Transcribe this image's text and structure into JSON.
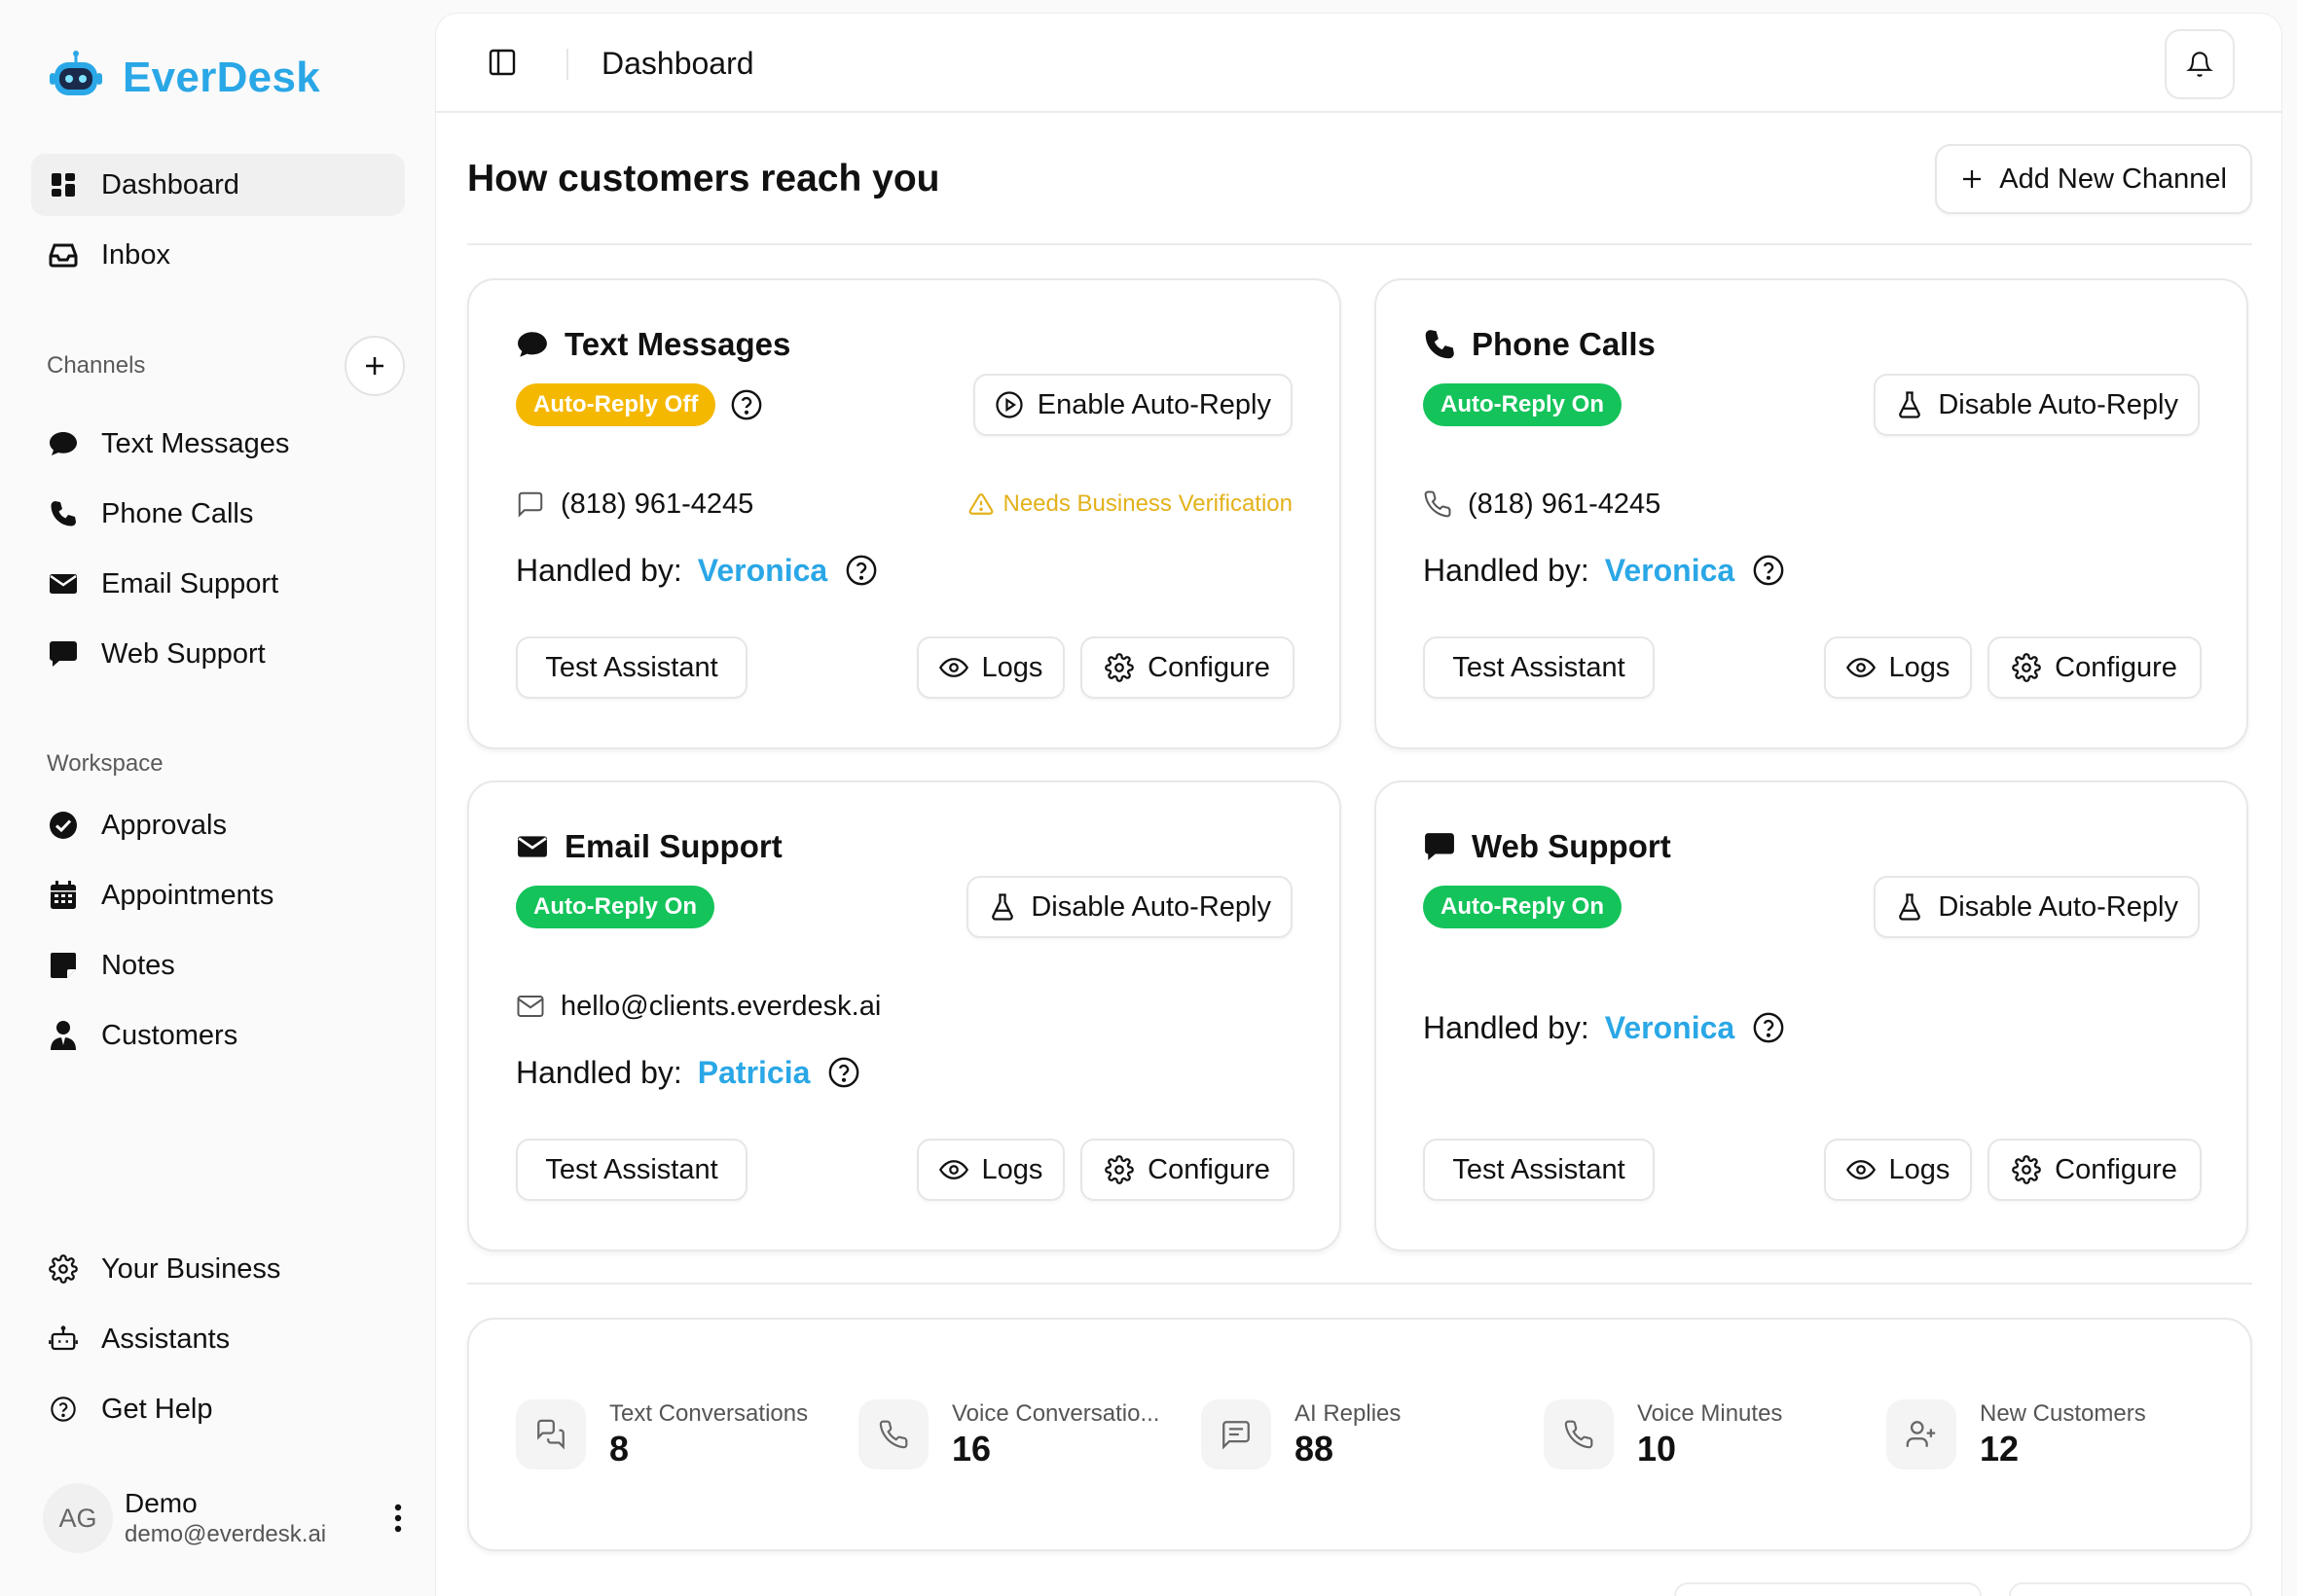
{
  "brand": {
    "name": "EverDesk",
    "accent": "#2aa7e6"
  },
  "sidebar": {
    "main_items": [
      {
        "label": "Dashboard",
        "icon": "dashboard-icon",
        "active": true
      },
      {
        "label": "Inbox",
        "icon": "inbox-icon"
      }
    ],
    "channels_heading": "Channels",
    "channel_items": [
      {
        "label": "Text Messages",
        "icon": "chat-bubble-icon"
      },
      {
        "label": "Phone Calls",
        "icon": "phone-icon"
      },
      {
        "label": "Email Support",
        "icon": "envelope-icon"
      },
      {
        "label": "Web Support",
        "icon": "message-square-icon"
      }
    ],
    "workspace_heading": "Workspace",
    "workspace_items": [
      {
        "label": "Approvals",
        "icon": "check-circle-icon"
      },
      {
        "label": "Appointments",
        "icon": "calendar-icon"
      },
      {
        "label": "Notes",
        "icon": "note-icon"
      },
      {
        "label": "Customers",
        "icon": "user-tie-icon"
      }
    ],
    "bottom_items": [
      {
        "label": "Your Business",
        "icon": "gear-icon"
      },
      {
        "label": "Assistants",
        "icon": "bot-icon"
      },
      {
        "label": "Get Help",
        "icon": "help-circle-icon"
      }
    ],
    "user": {
      "initials": "AG",
      "name": "Demo",
      "email": "demo@everdesk.ai"
    }
  },
  "header": {
    "title": "Dashboard"
  },
  "main": {
    "section_title": "How customers reach you",
    "add_channel_label": "Add New Channel",
    "handled_by_label": "Handled by:",
    "buttons": {
      "test": "Test Assistant",
      "logs": "Logs",
      "configure": "Configure"
    },
    "cards": [
      {
        "name": "Text Messages",
        "status": "Auto-Reply Off",
        "toggle": "Enable Auto-Reply",
        "contact": "(818) 961-4245",
        "warning": "Needs Business Verification",
        "agent": "Veronica"
      },
      {
        "name": "Phone Calls",
        "status": "Auto-Reply On",
        "toggle": "Disable Auto-Reply",
        "contact": "(818) 961-4245",
        "agent": "Veronica"
      },
      {
        "name": "Email Support",
        "status": "Auto-Reply On",
        "toggle": "Disable Auto-Reply",
        "contact": "hello@clients.everdesk.ai",
        "agent": "Patricia"
      },
      {
        "name": "Web Support",
        "status": "Auto-Reply On",
        "toggle": "Disable Auto-Reply",
        "agent": "Veronica"
      }
    ],
    "status_colors": {
      "off": "#f5b800",
      "on": "#14c35a",
      "warning": "#e3b11a"
    },
    "stats": [
      {
        "label": "Text Conversations",
        "value": "8",
        "icon": "chat-bubbles-icon"
      },
      {
        "label": "Voice Conversatio...",
        "value": "16",
        "icon": "phone-icon"
      },
      {
        "label": "AI Replies",
        "value": "88",
        "icon": "message-lines-icon"
      },
      {
        "label": "Voice Minutes",
        "value": "10",
        "icon": "phone-icon"
      },
      {
        "label": "New Customers",
        "value": "12",
        "icon": "user-plus-icon"
      }
    ]
  }
}
